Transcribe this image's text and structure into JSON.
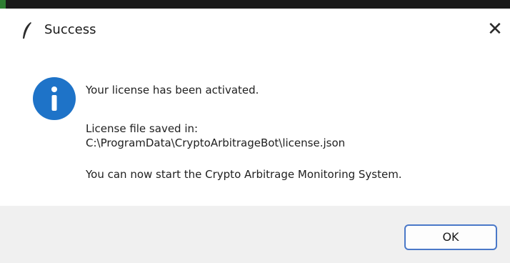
{
  "window": {
    "title": "Success",
    "close_glyph": "✕",
    "title_icon": "feather-icon",
    "close_icon": "close-icon"
  },
  "message": {
    "icon": "info-icon",
    "icon_color": "#1e73c8",
    "line1": "Your license has been activated.",
    "line2": "License file saved in:",
    "line3": "C:\\ProgramData\\CryptoArbitrageBot\\license.json",
    "line4": "You can now start the Crypto Arbitrage Monitoring System."
  },
  "footer": {
    "ok_label": "OK"
  },
  "colors": {
    "footer_bg": "#f0f0f0",
    "button_border": "#4a78c8"
  }
}
